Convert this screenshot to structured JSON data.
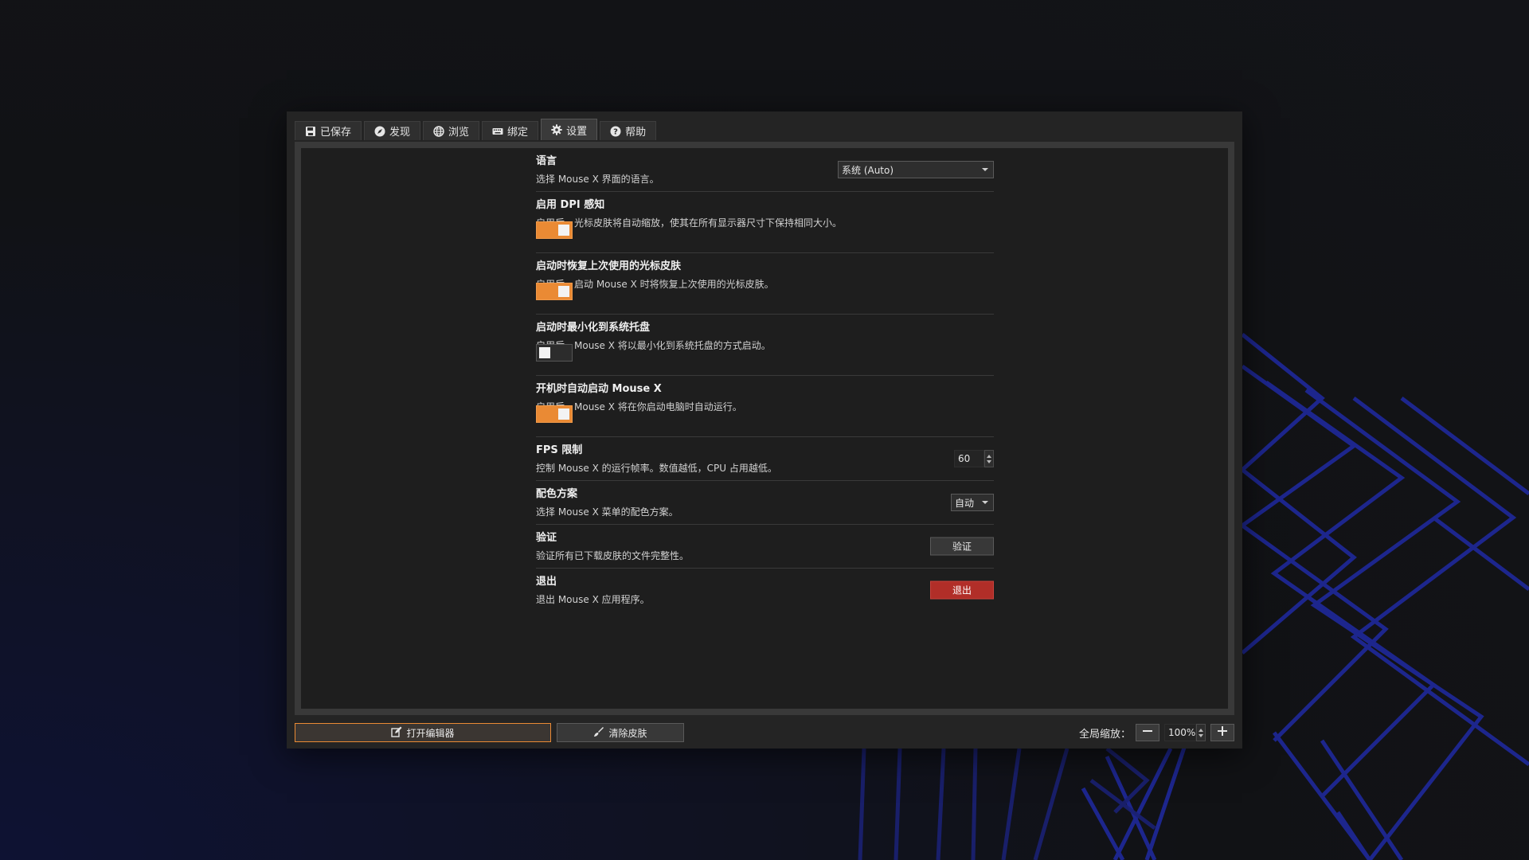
{
  "tabs": [
    {
      "label": "已保存",
      "icon": "save-icon",
      "active": false
    },
    {
      "label": "发现",
      "icon": "compass-icon",
      "active": false
    },
    {
      "label": "浏览",
      "icon": "globe-icon",
      "active": false
    },
    {
      "label": "绑定",
      "icon": "keyboard-icon",
      "active": false
    },
    {
      "label": "设置",
      "icon": "gear-icon",
      "active": true
    },
    {
      "label": "帮助",
      "icon": "help-icon",
      "active": false
    }
  ],
  "settings": {
    "language": {
      "title": "语言",
      "desc": "选择 Mouse X 界面的语言。",
      "value": "系统 (Auto)"
    },
    "dpi": {
      "title": "启用 DPI 感知",
      "desc": "启用后，光标皮肤将自动缩放，使其在所有显示器尺寸下保持相同大小。",
      "on": true
    },
    "restore": {
      "title": "启动时恢复上次使用的光标皮肤",
      "desc": "启用后，启动 Mouse X 时将恢复上次使用的光标皮肤。",
      "on": true
    },
    "minimize": {
      "title": "启动时最小化到系统托盘",
      "desc": "启用后，Mouse X 将以最小化到系统托盘的方式启动。",
      "on": false
    },
    "autostart": {
      "title": "开机时自动启动 Mouse X",
      "desc": "启用后，Mouse X 将在你启动电脑时自动运行。",
      "on": true
    },
    "fps": {
      "title": "FPS 限制",
      "desc": "控制 Mouse X 的运行帧率。数值越低，CPU 占用越低。",
      "value": "60"
    },
    "scheme": {
      "title": "配色方案",
      "desc": "选择 Mouse X 菜单的配色方案。",
      "value": "自动"
    },
    "verify": {
      "title": "验证",
      "desc": "验证所有已下载皮肤的文件完整性。",
      "button": "验证"
    },
    "exit": {
      "title": "退出",
      "desc": "退出 Mouse X 应用程序。",
      "button": "退出"
    }
  },
  "bottom": {
    "editor_label": "打开编辑器",
    "clear_label": "清除皮肤",
    "zoom_label": "全局缩放：",
    "zoom_value": "100%"
  },
  "colors": {
    "accent": "#ea8a34",
    "danger": "#b12e28",
    "bg_lines": "#1f2aa0"
  }
}
